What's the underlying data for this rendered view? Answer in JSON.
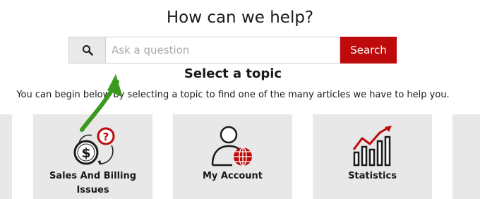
{
  "header": {
    "title": "How can we help?"
  },
  "search": {
    "placeholder": "Ask a question",
    "button_label": "Search",
    "icon": "search-icon"
  },
  "topics": {
    "heading": "Select a topic",
    "intro": "You can begin below by selecting a topic to find one of the many articles we have to help you.",
    "items": [
      {
        "label": "Sales And Billing Issues",
        "icon": "dollar-question-icon"
      },
      {
        "label": "My Account",
        "icon": "user-globe-icon"
      },
      {
        "label": "Statistics",
        "icon": "bar-chart-icon"
      }
    ]
  },
  "colors": {
    "accent": "#bd0a0a",
    "card": "#e8e8e8",
    "arrow": "#3a9a1e"
  }
}
